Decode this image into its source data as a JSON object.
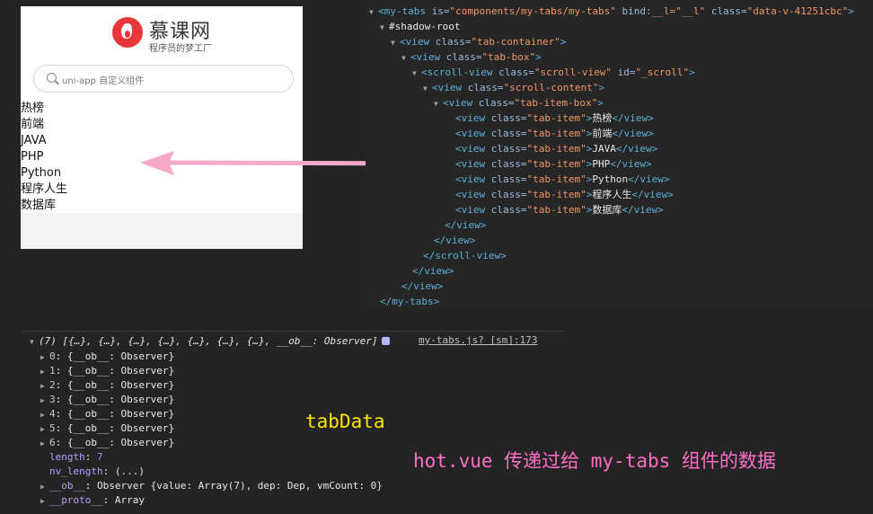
{
  "phone": {
    "logo_name": "慕课网",
    "logo_slogan": "程序员的梦工厂",
    "search_placeholder": "uni-app 自定义组件",
    "tabs": [
      "热榜",
      "前端",
      "JAVA",
      "PHP",
      "Python",
      "程序人生",
      "数据库"
    ]
  },
  "elements": {
    "root": {
      "tag": "my-tabs",
      "is": "components/my-tabs/my-tabs",
      "bind": "__l=\"__l\"",
      "class": "data-v-41251cbc"
    },
    "shadow_root": "#shadow-root",
    "tab_container_class": "tab-container",
    "tab_box_class": "tab-box",
    "scroll_view_class": "scroll-view",
    "scroll_view_id": "_scroll",
    "scroll_content_class": "scroll-content",
    "tab_item_box_class": "tab-item-box",
    "tab_item_class": "tab-item",
    "items": [
      "热榜",
      "前端",
      "JAVA",
      "PHP",
      "Python",
      "程序人生",
      "数据库"
    ],
    "close_view": "</view>",
    "close_scroll": "</scroll-view>",
    "close_root": "</my-tabs>"
  },
  "console": {
    "summary": "(7) [{…}, {…}, {…}, {…}, {…}, {…}, {…}, __ob__: Observer]",
    "source": "my-tabs.js? [sm]:173",
    "entries": [
      {
        "key": "0",
        "value": "{__ob__: Observer}"
      },
      {
        "key": "1",
        "value": "{__ob__: Observer}"
      },
      {
        "key": "2",
        "value": "{__ob__: Observer}"
      },
      {
        "key": "3",
        "value": "{__ob__: Observer}"
      },
      {
        "key": "4",
        "value": "{__ob__: Observer}"
      },
      {
        "key": "5",
        "value": "{__ob__: Observer}"
      },
      {
        "key": "6",
        "value": "{__ob__: Observer}"
      }
    ],
    "length_key": "length",
    "length_value": "7",
    "nv_length_key": "nv_length",
    "nv_length_value": "(...)",
    "ob_key": "__ob__",
    "ob_value": "Observer {value: Array(7), dep: Dep, vmCount: 0}",
    "proto_key": "__proto__",
    "proto_value": "Array"
  },
  "annotations": {
    "tab_data": "tabData",
    "description": "hot.vue 传递过给 my-tabs 组件的数据"
  },
  "colors": {
    "arrow": "#f7a8c8",
    "yellow_note": "#ffe400",
    "pink_note": "#ff6ec7"
  }
}
